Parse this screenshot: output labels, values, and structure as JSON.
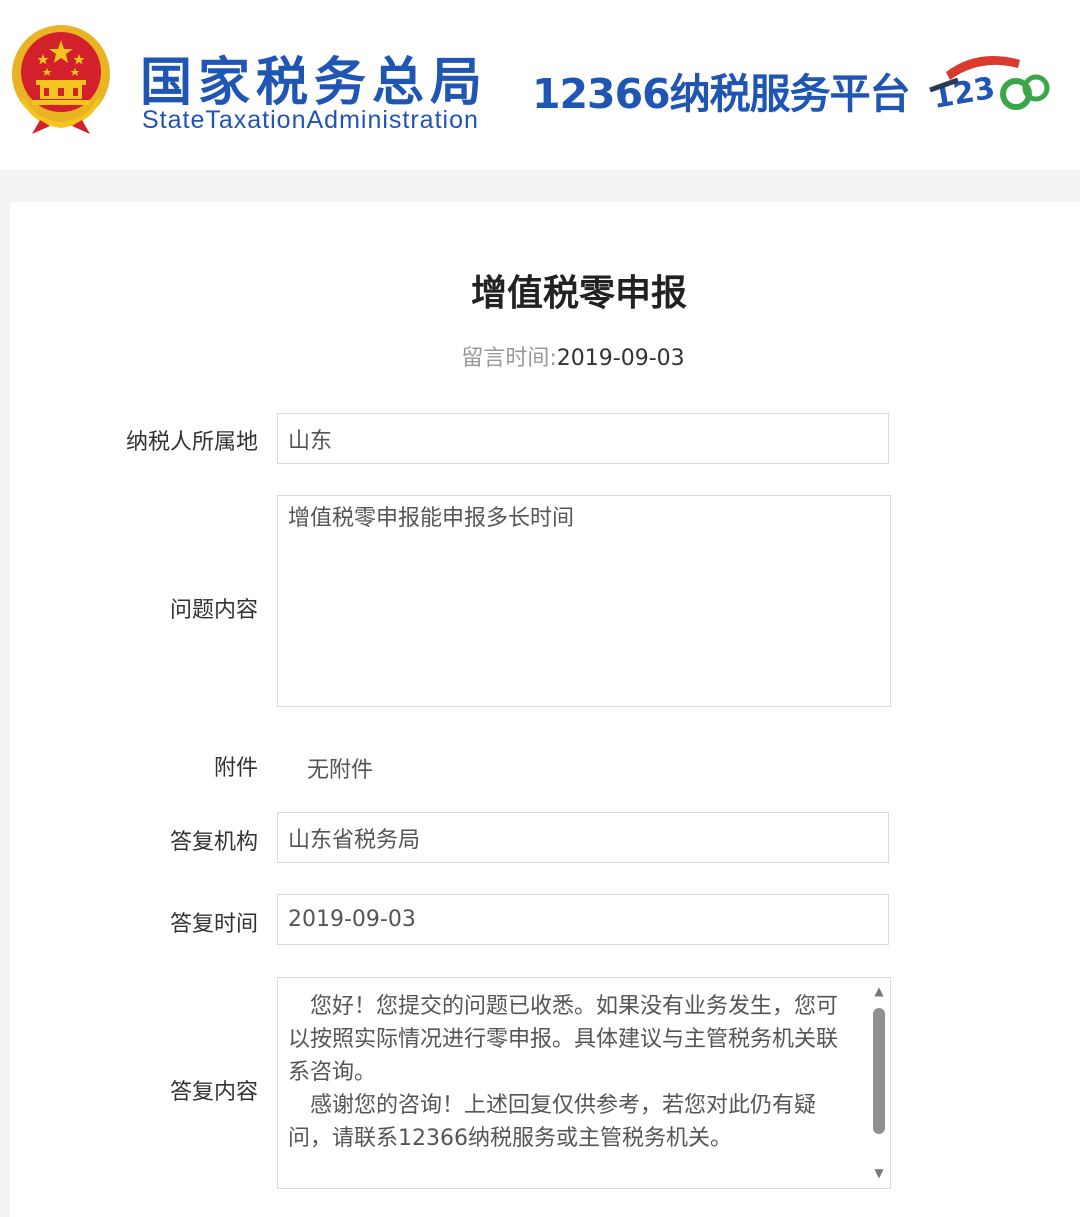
{
  "header": {
    "org_name_cn": "国家税务总局",
    "org_name_en": "StateTaxationAdministration",
    "platform_name": "12366纳税服务平台",
    "brand_color": "#1f55b3",
    "emblem_icon": "national-emblem-icon",
    "platform_logo_icon": "12366-logo-icon"
  },
  "page": {
    "title": "增值税零申报",
    "posted_label": "留言时间:",
    "posted_date": "2019-09-03"
  },
  "form": {
    "location_label": "纳税人所属地",
    "location_value": "山东",
    "question_label": "问题内容",
    "question_value": "增值税零申报能申报多长时间",
    "attachment_label": "附件",
    "attachment_value": "无附件",
    "reply_org_label": "答复机构",
    "reply_org_value": "山东省税务局",
    "reply_time_label": "答复时间",
    "reply_time_value": "2019-09-03",
    "reply_content_label": "答复内容",
    "reply_paragraph_1": "您好！您提交的问题已收悉。如果没有业务发生，您可以按照实际情况进行零申报。具体建议与主管税务机关联系咨询。",
    "reply_paragraph_2": "感谢您的咨询！上述回复仅供参考，若您对此仍有疑问，请联系12366纳税服务或主管税务机关。"
  }
}
